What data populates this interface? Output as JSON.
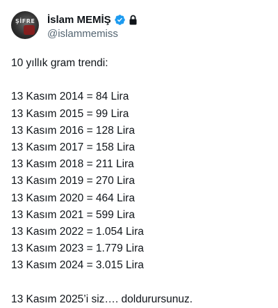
{
  "author": {
    "display_name": "İslam MEMİŞ",
    "handle": "@islammemiss",
    "avatar_text": "ŞİFRE"
  },
  "icons": {
    "verified": "verified-badge-icon",
    "lock": "lock-icon"
  },
  "colors": {
    "verified_blue": "#1d9bf0",
    "handle_gray": "#536471",
    "text": "#0f1419"
  },
  "tweet": {
    "intro": "10 yıllık gram trendi:",
    "prices": [
      "13 Kasım 2014 = 84 Lira",
      "13 Kasım 2015 = 99 Lira",
      "13 Kasım 2016 = 128 Lira",
      "13 Kasım 2017 = 158 Lira",
      "13 Kasım 2018 = 211 Lira",
      "13 Kasım 2019 = 270 Lira",
      "13 Kasım 2020 = 464 Lira",
      "13 Kasım 2021 = 599 Lira",
      "13 Kasım 2022 = 1.054 Lira",
      "13 Kasım 2023 = 1.779 Lira",
      "13 Kasım 2024 = 3.015 Lira"
    ],
    "closing": "13 Kasım 2025’i siz…. doldurursunuz."
  }
}
